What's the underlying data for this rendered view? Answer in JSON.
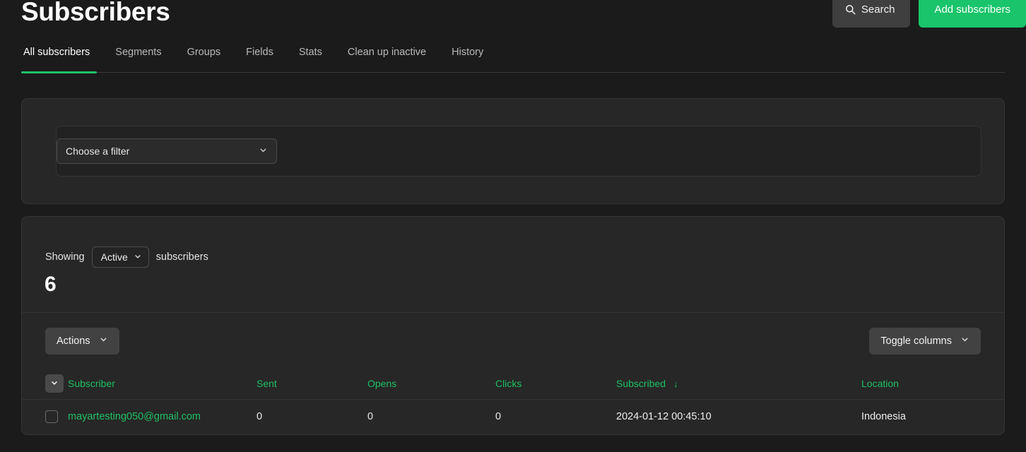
{
  "header": {
    "title": "Subscribers",
    "search_label": "Search",
    "search_icon": "search-icon",
    "add_label": "Add subscribers"
  },
  "tabs": [
    {
      "label": "All subscribers",
      "active": true
    },
    {
      "label": "Segments",
      "active": false
    },
    {
      "label": "Groups",
      "active": false
    },
    {
      "label": "Fields",
      "active": false
    },
    {
      "label": "Stats",
      "active": false
    },
    {
      "label": "Clean up inactive",
      "active": false
    },
    {
      "label": "History",
      "active": false
    }
  ],
  "filter_panel": {
    "select_value": "Choose a filter",
    "caret_icon": "chevron-down-icon"
  },
  "list_panel": {
    "showing_prefix": "Showing",
    "status_value": "Active",
    "showing_suffix": "subscribers",
    "count": "6",
    "actions_label": "Actions",
    "toggle_columns_label": "Toggle columns",
    "caret_icon": "chevron-down-icon"
  },
  "table": {
    "columns": [
      "Subscriber",
      "Sent",
      "Opens",
      "Clicks",
      "Subscribed",
      "Location"
    ],
    "sort_column": "Subscribed",
    "sort_arrow": "↓",
    "rows": [
      {
        "subscriber": "mayartesting050@gmail.com",
        "sent": "0",
        "opens": "0",
        "clicks": "0",
        "subscribed": "2024-01-12 00:45:10",
        "location": "Indonesia"
      }
    ]
  },
  "colors": {
    "accent_green": "#19c46a",
    "link_green": "#1fbf66",
    "page_bg": "#1b1b1b",
    "card_bg": "#272727"
  }
}
